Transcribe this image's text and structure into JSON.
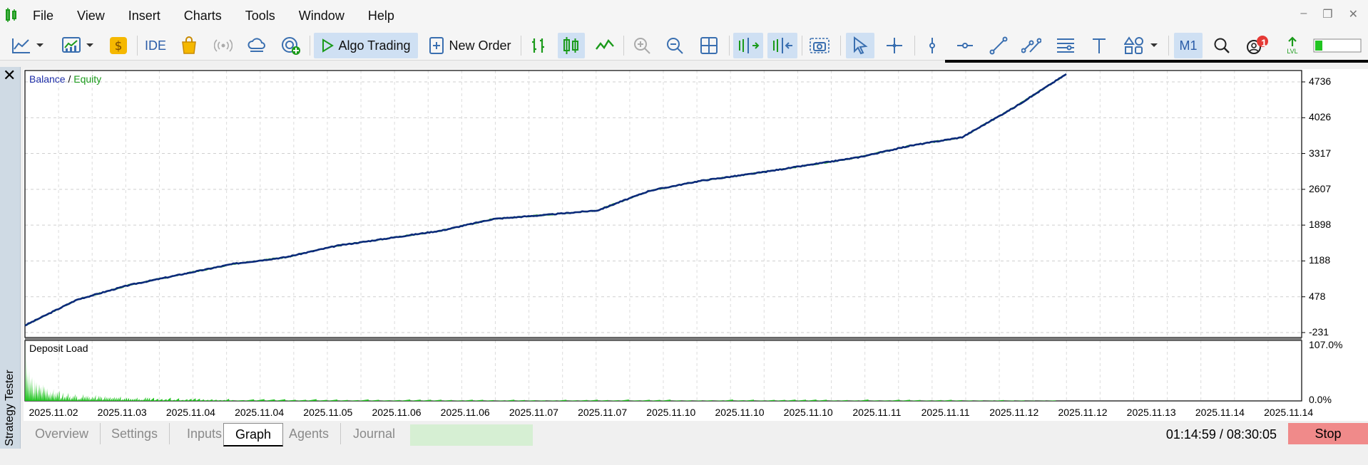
{
  "menu": [
    "File",
    "View",
    "Insert",
    "Charts",
    "Tools",
    "Window",
    "Help"
  ],
  "window_controls": {
    "minimize": "–",
    "restore": "❐",
    "close": "✕"
  },
  "toolbar": {
    "ide_label": "IDE",
    "algo_trading_label": "Algo Trading",
    "new_order_label": "New Order",
    "timeframe_label": "M1",
    "notification_count": "1",
    "lvl_label": "LVL"
  },
  "panel": {
    "close_label": "✕",
    "title": "Strategy Tester"
  },
  "chart": {
    "legend_balance": "Balance",
    "legend_sep": " / ",
    "legend_equity": "Equity",
    "deposit_label": "Deposit Load",
    "colors": {
      "balance": "#1f2fa8",
      "equity": "#1a9a1a",
      "deposit": "#21c421"
    }
  },
  "chart_data": [
    {
      "type": "line",
      "title": "Balance / Equity",
      "y_ticks": [
        "4736",
        "4026",
        "3317",
        "2607",
        "1898",
        "1188",
        "478",
        "-231"
      ],
      "ylim": [
        -231,
        4736
      ],
      "x_tick_labels": [
        "2025.11.02",
        "2025.11.03",
        "2025.11.04",
        "2025.11.04",
        "2025.11.05",
        "2025.11.06",
        "2025.11.06",
        "2025.11.07",
        "2025.11.07",
        "2025.11.10",
        "2025.11.10",
        "2025.11.10",
        "2025.11.11",
        "2025.11.11",
        "2025.11.12",
        "2025.11.12",
        "2025.11.13",
        "2025.11.14",
        "2025.11.14"
      ],
      "series": [
        {
          "name": "Balance",
          "x": [
            0,
            5,
            10,
            15,
            20,
            25,
            30,
            35,
            40,
            45,
            50,
            55,
            60,
            65,
            70,
            75,
            80,
            85,
            90,
            95,
            100
          ],
          "values": [
            -90,
            420,
            710,
            920,
            1130,
            1260,
            1490,
            1640,
            1790,
            2020,
            2100,
            2190,
            2580,
            2780,
            2920,
            3080,
            3240,
            3470,
            3640,
            4230,
            4890
          ]
        },
        {
          "name": "Equity",
          "x": [
            0,
            5,
            10,
            15,
            20,
            25,
            30,
            35,
            40,
            45,
            50,
            55,
            60,
            65,
            70,
            75,
            80,
            85,
            90,
            95,
            100
          ],
          "values": [
            -90,
            420,
            710,
            920,
            1130,
            1260,
            1490,
            1640,
            1790,
            2020,
            2100,
            2190,
            2580,
            2780,
            2920,
            3080,
            3240,
            3470,
            3640,
            4230,
            4890
          ]
        }
      ]
    },
    {
      "type": "area",
      "title": "Deposit Load",
      "y_ticks": [
        "107.0%",
        "0.0%"
      ],
      "ylim": [
        0,
        107
      ],
      "x": [
        0,
        0.2,
        0.5,
        1,
        2,
        3,
        5,
        8,
        12,
        20,
        40,
        60,
        80,
        100
      ],
      "values": [
        100,
        60,
        45,
        30,
        22,
        16,
        10,
        7,
        5,
        3,
        2,
        2,
        2,
        1
      ]
    }
  ],
  "tabs": {
    "overview": "Overview",
    "settings": "Settings",
    "inputs": "Inputs",
    "graph": "Graph",
    "agents": "Agents",
    "journal": "Journal"
  },
  "status": {
    "time": "01:14:59 / 08:30:05",
    "stop_label": "Stop"
  }
}
